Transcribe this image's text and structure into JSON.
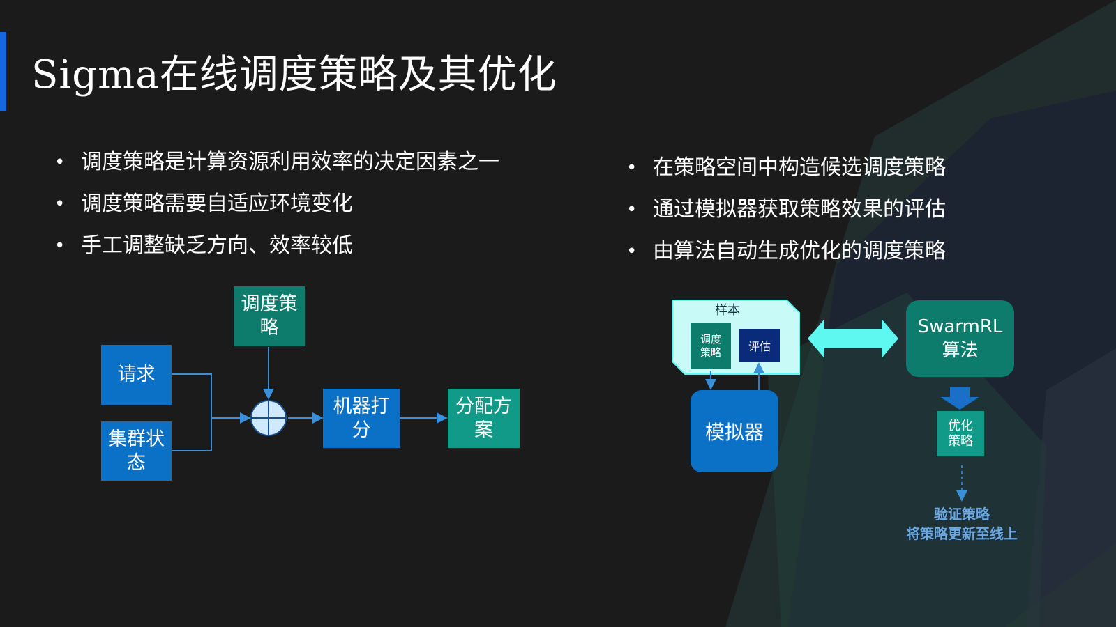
{
  "slide": {
    "title": "Sigma在线调度策略及其优化",
    "left_bullets": [
      "调度策略是计算资源利用效率的决定因素之一",
      "调度策略需要自适应环境变化",
      "手工调整缺乏方向、效率较低"
    ],
    "right_bullets": [
      "在策略空间中构造候选调度策略",
      "通过模拟器获取策略效果的评估",
      "由算法自动生成优化的调度策略"
    ],
    "bullet_glyph": "•"
  },
  "left_diagram": {
    "request": "请求",
    "cluster_state": "集群状态",
    "policy": "调度策略",
    "scoring": "机器打分",
    "assignment": "分配方案"
  },
  "right_diagram": {
    "sample_label": "样本",
    "sample_policy": "调度策略",
    "sample_eval": "评估",
    "simulator": "模拟器",
    "algorithm_line1": "SwarmRL",
    "algorithm_line2": "算法",
    "optimized_policy": "优化策略",
    "validate": "验证策略",
    "deploy": "将策略更新至线上"
  },
  "colors": {
    "background": "#1b1b1b",
    "accent": "#1668e0",
    "blue_box": "#0a71c6",
    "teal_box": "#0e7c6d",
    "bright_teal": "#119a87",
    "cyan": "#5ff8f0",
    "navy": "#0a2a7a",
    "sample_fill": "#c8fbf8",
    "merge_node": "#cfe9ff",
    "link_text": "#6fa8dc"
  }
}
